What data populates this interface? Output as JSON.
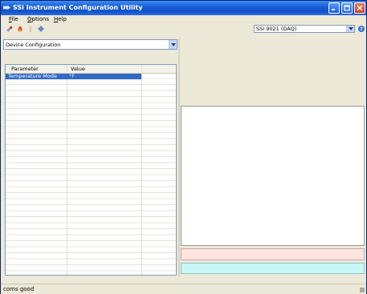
{
  "window": {
    "title": "SSi Instrument Configuration Utility"
  },
  "menu": [
    {
      "underline": "F",
      "rest": "ile"
    },
    {
      "underline": "O",
      "rest": "ptions"
    },
    {
      "underline": "H",
      "rest": "elp"
    }
  ],
  "toolbar": {
    "icons": [
      "connect-icon",
      "fire-icon",
      "probe-icon",
      "settings-gear-icon"
    ],
    "device_select": {
      "value": "SSI 9021 (DAQ)"
    },
    "help_label": "?"
  },
  "config": {
    "selected": "Device Configuration"
  },
  "grid": {
    "columns": [
      "Parameter",
      "Value"
    ],
    "rows": [
      {
        "parameter": "Temperature Mode",
        "value": "°F",
        "selected": true
      }
    ]
  },
  "status": {
    "text": "coms good"
  },
  "colors": {
    "titlebar": "#1b5fd6",
    "selection": "#316ac5",
    "pink_box": "#fde4e1",
    "cyan_box": "#c7f7f7"
  }
}
